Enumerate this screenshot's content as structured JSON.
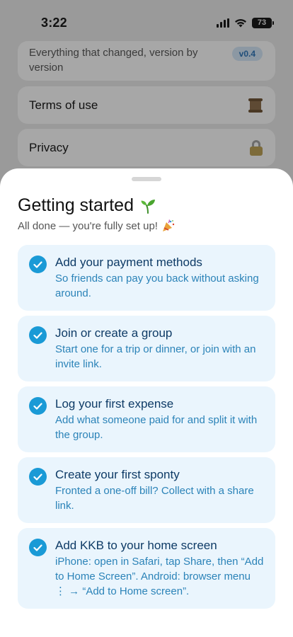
{
  "status_bar": {
    "time": "3:22",
    "battery": "73"
  },
  "background_page": {
    "changelog": {
      "description": "Everything that changed, version by version",
      "version": "v0.4"
    },
    "terms": {
      "label": "Terms of use"
    },
    "privacy": {
      "label": "Privacy"
    }
  },
  "sheet": {
    "title": "Getting started",
    "subtitle": "All done — you're fully set up!",
    "tasks": [
      {
        "title": "Add your payment methods",
        "description": "So friends can pay you back without asking around.",
        "done": true
      },
      {
        "title": "Join or create a group",
        "description": "Start one for a trip or dinner, or join with an invite link.",
        "done": true
      },
      {
        "title": "Log your first expense",
        "description": "Add what someone paid for and split it with the group.",
        "done": true
      },
      {
        "title": "Create your first sponty",
        "description": "Fronted a one-off bill? Collect with a share link.",
        "done": true
      },
      {
        "title": "Add KKB to your home screen",
        "description": "iPhone: open in Safari, tap Share, then “Add to Home Screen”. Android: browser menu ⋮ → “Add to Home screen”.",
        "done": true
      }
    ]
  },
  "colors": {
    "accent": "#1a9ad6",
    "task_bg": "#eaf5fd",
    "task_title": "#0e3b66",
    "task_desc": "#2b83b8"
  },
  "icons": [
    "signal-icon",
    "wifi-icon",
    "battery-icon",
    "scroll-icon",
    "lock-icon",
    "sprout-icon",
    "party-popper-icon",
    "check-circle-icon"
  ]
}
